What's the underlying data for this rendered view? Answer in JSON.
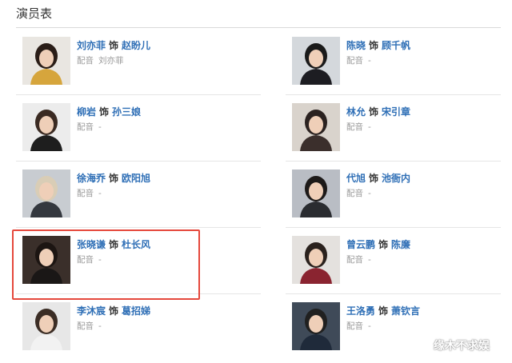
{
  "section": {
    "title": "演员表"
  },
  "cast_connector": "饰",
  "voice_label": "配音",
  "cast": [
    {
      "actor": "刘亦菲",
      "role": "赵盼儿",
      "voice": "刘亦菲",
      "photo_bg": "#e9e6e1",
      "photo_hair": "#2a1d17",
      "photo_top": "#d6a53c"
    },
    {
      "actor": "陈晓",
      "role": "顾千帆",
      "voice": "-",
      "photo_bg": "#d4d8dc",
      "photo_hair": "#1a1a1a",
      "photo_top": "#1d1d22"
    },
    {
      "actor": "柳岩",
      "role": "孙三娘",
      "voice": "-",
      "photo_bg": "#ececec",
      "photo_hair": "#3a2a22",
      "photo_top": "#1e1e1e"
    },
    {
      "actor": "林允",
      "role": "宋引章",
      "voice": "-",
      "photo_bg": "#d9d3cc",
      "photo_hair": "#2b2220",
      "photo_top": "#3b2f2c"
    },
    {
      "actor": "徐海乔",
      "role": "欧阳旭",
      "voice": "-",
      "photo_bg": "#c8ccd1",
      "photo_hair": "#d9cdb6",
      "photo_top": "#34383f"
    },
    {
      "actor": "代旭",
      "role": "池衙内",
      "voice": "-",
      "photo_bg": "#b9bdc4",
      "photo_hair": "#1d1a19",
      "photo_top": "#2a2c30"
    },
    {
      "actor": "张晓谦",
      "role": "杜长风",
      "voice": "-",
      "photo_bg": "#3a2f2a",
      "photo_hair": "#1c1512",
      "photo_top": "#1a1716"
    },
    {
      "actor": "曾云鹏",
      "role": "陈廉",
      "voice": "-",
      "photo_bg": "#e4e1de",
      "photo_hair": "#2a211d",
      "photo_top": "#8a2430"
    },
    {
      "actor": "李沐宸",
      "role": "葛招娣",
      "voice": "-",
      "photo_bg": "#e7e7e7",
      "photo_hair": "#3b2d25",
      "photo_top": "#f2f2f2"
    },
    {
      "actor": "王洛勇",
      "role": "萧钦言",
      "voice": "-",
      "photo_bg": "#3f4a58",
      "photo_hair": "#202020",
      "photo_top": "#1f2a3a"
    }
  ],
  "watermark": "缘木不求娱",
  "colors": {
    "link": "#2f6fb6",
    "highlight": "#e5483c",
    "muted": "#999999"
  }
}
